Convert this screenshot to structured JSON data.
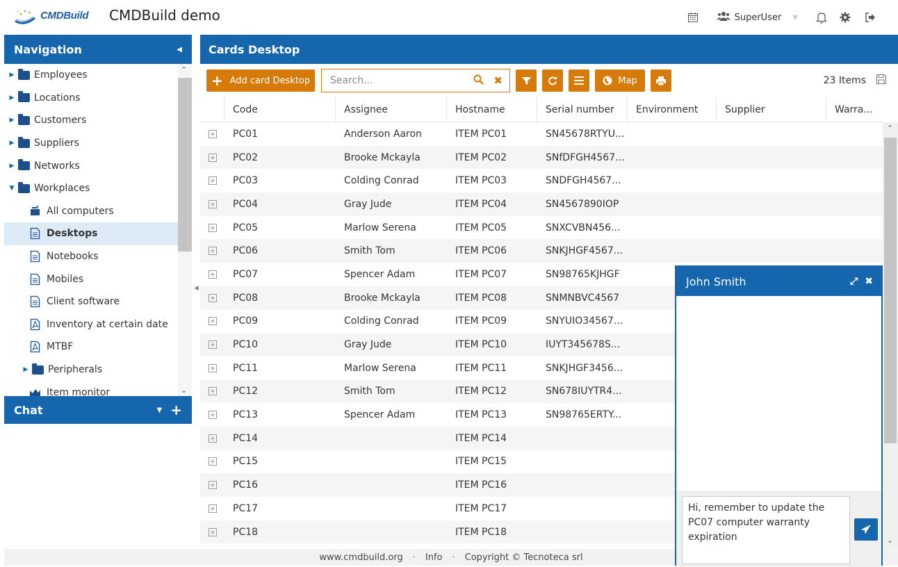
{
  "header": {
    "logo_text": "CMDBuild",
    "app_title": "CMDBuild demo",
    "user_name": "SuperUser",
    "icons": [
      "calendar-icon",
      "users-icon",
      "bell-icon",
      "gear-icon",
      "logout-icon"
    ]
  },
  "navigation": {
    "title": "Navigation",
    "items": [
      {
        "label": "Employees",
        "type": "folder",
        "expanded": false
      },
      {
        "label": "Locations",
        "type": "folder",
        "expanded": false
      },
      {
        "label": "Customers",
        "type": "folder",
        "expanded": false
      },
      {
        "label": "Suppliers",
        "type": "folder",
        "expanded": false
      },
      {
        "label": "Networks",
        "type": "folder",
        "expanded": false
      },
      {
        "label": "Workplaces",
        "type": "folder",
        "expanded": true
      },
      {
        "label": "All computers",
        "type": "superclass"
      },
      {
        "label": "Desktops",
        "type": "doc",
        "selected": true
      },
      {
        "label": "Notebooks",
        "type": "doc"
      },
      {
        "label": "Mobiles",
        "type": "doc"
      },
      {
        "label": "Client software",
        "type": "doc"
      },
      {
        "label": "Inventory at certain date",
        "type": "pdf"
      },
      {
        "label": "MTBF",
        "type": "pdf"
      },
      {
        "label": "Peripherals",
        "type": "folder",
        "expanded": false
      },
      {
        "label": "Item monitor",
        "type": "dashboard"
      }
    ]
  },
  "chat_panel": {
    "title": "Chat"
  },
  "main": {
    "title": "Cards Desktop",
    "toolbar": {
      "add_label": "Add card Desktop",
      "search_placeholder": "Search...",
      "map_label": "Map",
      "items_count": "23 Items"
    },
    "columns": [
      "Code",
      "Assignee",
      "Hostname",
      "Serial number",
      "Environment",
      "Supplier",
      "Warra..."
    ],
    "rows": [
      [
        "PC01",
        "Anderson Aaron",
        "ITEM PC01",
        "SN45678RTYU..."
      ],
      [
        "PC02",
        "Brooke Mckayla",
        "ITEM PC02",
        "SNfDFGH4567..."
      ],
      [
        "PC03",
        "Colding Conrad",
        "ITEM PC03",
        "SNDFGH4567..."
      ],
      [
        "PC04",
        "Gray Jude",
        "ITEM PC04",
        "SN4567890IOP"
      ],
      [
        "PC05",
        "Marlow Serena",
        "ITEM PC05",
        "SNXCVBN456..."
      ],
      [
        "PC06",
        "Smith Tom",
        "ITEM PC06",
        "SNKJHGF4567..."
      ],
      [
        "PC07",
        "Spencer Adam",
        "ITEM PC07",
        "SN98765KJHGF"
      ],
      [
        "PC08",
        "Brooke Mckayla",
        "ITEM PC08",
        "SNMNBVC4567"
      ],
      [
        "PC09",
        "Colding Conrad",
        "ITEM PC09",
        "SNYUIO34567..."
      ],
      [
        "PC10",
        "Gray Jude",
        "ITEM PC10",
        "IUYT345678S..."
      ],
      [
        "PC11",
        "Marlow Serena",
        "ITEM PC11",
        "SNKJHGF3456..."
      ],
      [
        "PC12",
        "Smith Tom",
        "ITEM PC12",
        "SN678IUYTR4..."
      ],
      [
        "PC13",
        "Spencer Adam",
        "ITEM PC13",
        "SN98765ERTY..."
      ],
      [
        "PC14",
        "",
        "ITEM PC14",
        ""
      ],
      [
        "PC15",
        "",
        "ITEM PC15",
        ""
      ],
      [
        "PC16",
        "",
        "ITEM PC16",
        ""
      ],
      [
        "PC17",
        "",
        "ITEM PC17",
        ""
      ],
      [
        "PC18",
        "",
        "ITEM PC18",
        ""
      ]
    ]
  },
  "chat_window": {
    "title": "John Smith",
    "message_draft": "Hi, remember to update the PC07 computer warranty expiration"
  },
  "footer": {
    "site": "www.cmdbuild.org",
    "info": "Info",
    "copyright": "Copyright © Tecnoteca srl"
  },
  "colors": {
    "primary": "#1666ae",
    "accent": "#d67a0a",
    "selected_bg": "#ddebf7"
  }
}
